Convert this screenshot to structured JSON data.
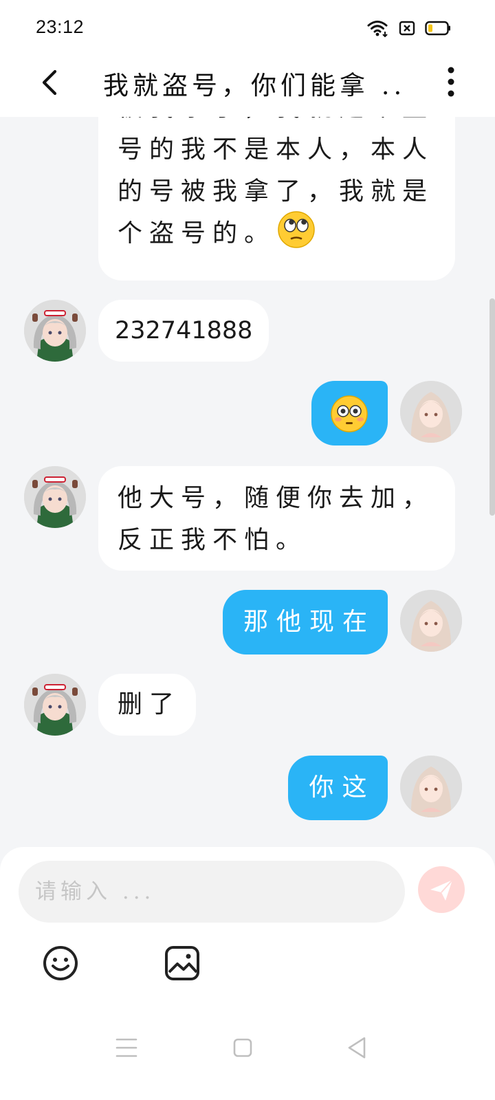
{
  "status_bar": {
    "time": "23:12",
    "icons": [
      "wifi-icon",
      "sim-card-icon",
      "battery-icon"
    ]
  },
  "header": {
    "title": "我就盗号，你们能拿 ...",
    "icons": [
      "back-arrow-icon",
      "more-vert-icon"
    ]
  },
  "messages": {
    "top_partial": {
      "sender": "them",
      "line1": "被我拿了，我就是个盗",
      "line2": "号的我不是本人，本人",
      "line3": "的号被我拿了，我就是",
      "line4": "个盗号的。",
      "emoji": "rolling-eyes-emoji"
    },
    "m1": {
      "sender": "them",
      "text": "232741888"
    },
    "m2": {
      "sender": "me",
      "emoji": "flushed-face-emoji"
    },
    "m3": {
      "sender": "them",
      "line1": "他大号，随便你去加，",
      "line2": "反正我不怕。"
    },
    "m4": {
      "sender": "me",
      "text": "那他现在"
    },
    "m5": {
      "sender": "them",
      "text": "删了"
    },
    "m6": {
      "sender": "me",
      "text": "你这"
    }
  },
  "composer": {
    "placeholder": "请输入 ...",
    "value": "",
    "icons": [
      "send-icon",
      "emoji-smile-icon",
      "image-icon"
    ]
  },
  "nav_bar": {
    "icons": [
      "menu-icon",
      "home-square-icon",
      "back-triangle-icon"
    ]
  },
  "colors": {
    "outgoing_bubble": "#2ab4f6",
    "incoming_bubble": "#ffffff",
    "background": "#f4f5f7",
    "send_button_disabled": "#ffd9d7"
  }
}
